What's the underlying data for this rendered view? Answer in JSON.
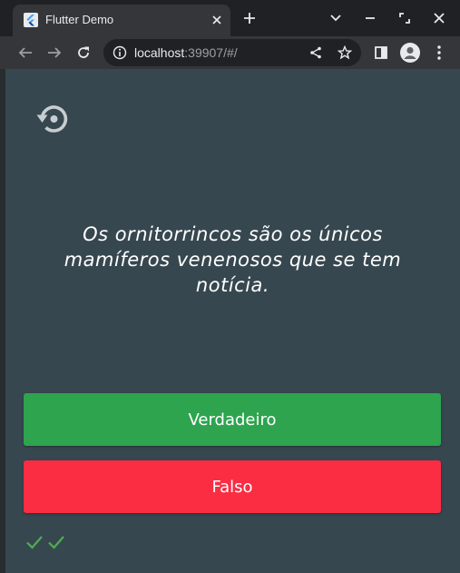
{
  "browser": {
    "tab_title": "Flutter Demo",
    "url_host": "localhost",
    "url_rest": ":39907/#/",
    "icons": {
      "favicon": "flutter-logo-icon",
      "tab_close": "close-icon",
      "new_tab": "plus-icon",
      "tab_search": "chevron-down-icon",
      "minimize": "minimize-icon",
      "restore": "restore-icon",
      "close_window": "close-icon",
      "back": "arrow-left-icon",
      "forward": "arrow-right-icon",
      "reload": "reload-icon",
      "site_info": "info-icon",
      "share": "share-icon",
      "bookmark": "star-icon",
      "side_panel": "side-panel-icon",
      "profile": "avatar-icon",
      "menu": "kebab-menu-icon"
    }
  },
  "app": {
    "restart_icon": "restart-icon",
    "question": "Os ornitorrincos são os únicos mamíferos venenosos que se tem notícia.",
    "true_label": "Verdadeiro",
    "false_label": "Falso",
    "score": [
      "correct",
      "correct"
    ],
    "colors": {
      "background": "#37474f",
      "true_button": "#2ea44f",
      "false_button": "#fa2d43",
      "check": "#4caf50"
    }
  }
}
